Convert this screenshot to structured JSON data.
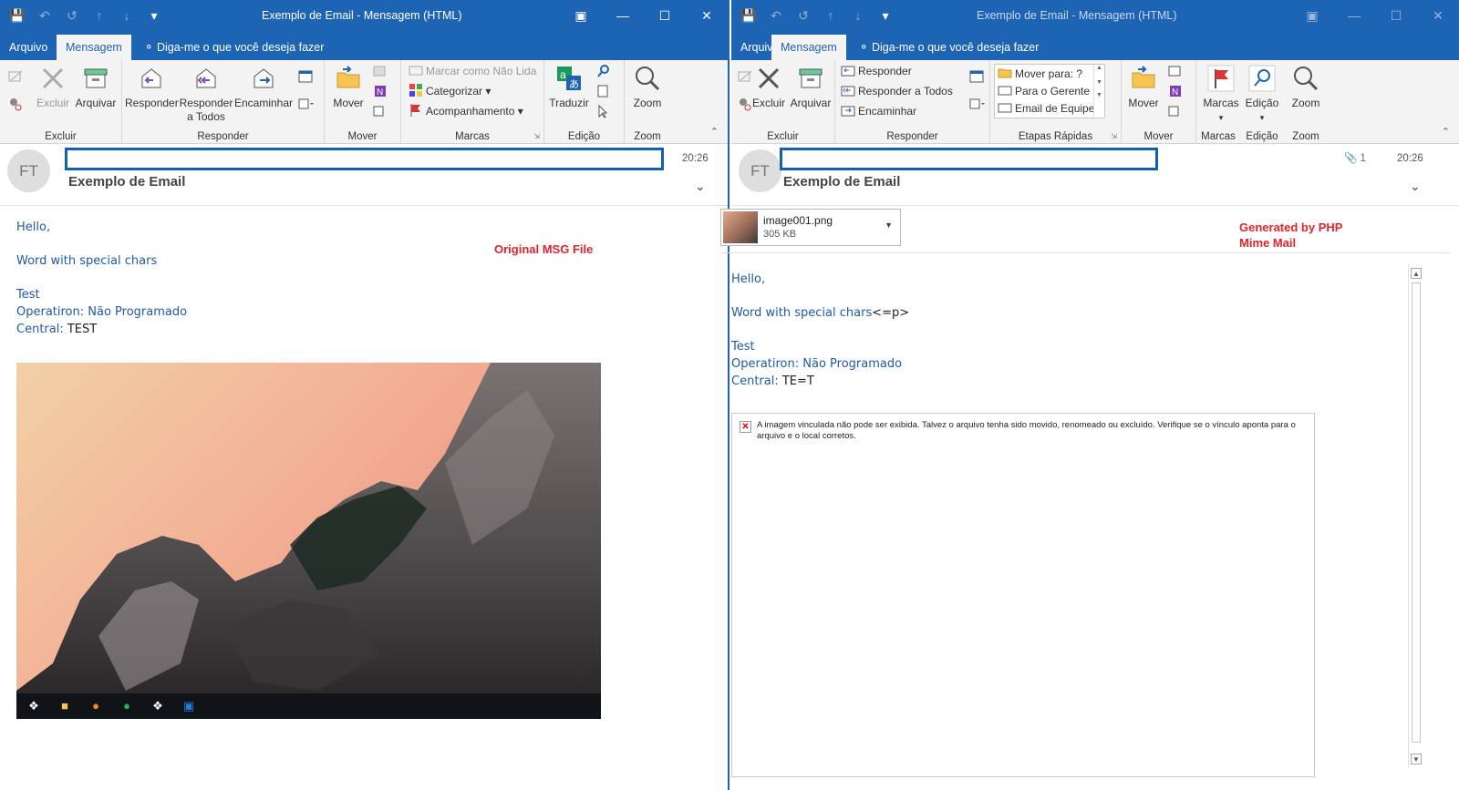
{
  "left": {
    "window_title": "Exemplo de Email  -  Mensagem (HTML)",
    "tabs": {
      "file": "Arquivo",
      "message": "Mensagem",
      "tell_me": "Diga-me o que você deseja fazer"
    },
    "ribbon": {
      "delete_group": {
        "label": "Excluir",
        "ignore": "Ignorar",
        "delete": "Excluir",
        "archive": "Arquivar"
      },
      "respond_group": {
        "label": "Responder",
        "reply": "Responder",
        "reply_all": "Responder a Todos",
        "forward": "Encaminhar"
      },
      "move_group": {
        "label": "Mover",
        "move": "Mover"
      },
      "tags_group": {
        "label": "Marcas",
        "mark_unread": "Marcar como Não Lida",
        "categorize": "Categorizar",
        "followup": "Acompanhamento"
      },
      "edit_group": {
        "label": "Edição",
        "translate": "Traduzir"
      },
      "zoom_group": {
        "label": "Zoom",
        "zoom": "Zoom"
      }
    },
    "header": {
      "avatar_initials": "FT",
      "subject": "Exemplo de Email",
      "time": "20:26"
    },
    "annotation": "Original MSG File",
    "body": {
      "greeting": "Hello,",
      "line1": "Word with special chars",
      "test": "Test",
      "operatiron_label": "Operatiron: ",
      "operatiron_value": "Não Programado",
      "central_label": "Central: ",
      "central_value": "TEST"
    },
    "taskbar_icons": [
      "windows-start-icon",
      "file-explorer-icon",
      "firefox-icon",
      "spotify-icon",
      "slack-icon",
      "outlook-icon"
    ]
  },
  "right": {
    "window_title": "Exemplo de Email  -  Mensagem (HTML)",
    "tabs": {
      "file": "Arquivo",
      "message": "Mensagem",
      "tell_me": "Diga-me o que você deseja fazer"
    },
    "ribbon": {
      "delete_group": {
        "label": "Excluir",
        "delete": "Excluir",
        "archive": "Arquivar"
      },
      "respond_group": {
        "label": "Responder",
        "reply": "Responder",
        "reply_all": "Responder a Todos",
        "forward": "Encaminhar"
      },
      "quick_steps_group": {
        "label": "Etapas Rápidas",
        "items": [
          "Mover para: ?",
          "Para o Gerente",
          "Email de Equipe"
        ]
      },
      "move_group": {
        "label": "Mover",
        "move": "Mover"
      },
      "tags_group": {
        "label": "Marcas",
        "tags": "Marcas"
      },
      "edit_group": {
        "label": "Edição",
        "edit": "Edição"
      },
      "zoom_group": {
        "label": "Zoom",
        "zoom": "Zoom"
      }
    },
    "header": {
      "avatar_initials": "FT",
      "subject": "Exemplo de Email",
      "time": "20:26",
      "attachment_count": "1"
    },
    "attachment": {
      "name": "image001.png",
      "size": "305 KB"
    },
    "annotation_line1": "Generated by PHP",
    "annotation_line2": "Mime Mail",
    "body": {
      "greeting": "Hello,",
      "line1": "Word with special chars",
      "line1_suffix": "<=p>",
      "test": "Test",
      "operatiron_label": "Operatiron: ",
      "operatiron_value": "Não Programado",
      "central_label": "Central: ",
      "central_value": "TE=T"
    },
    "broken_image_message": "A imagem vinculada não pode ser exibida. Talvez o arquivo tenha sido movido, renomeado ou excluído. Verifique se o vínculo aponta para o arquivo e o local corretos."
  },
  "colors": {
    "titlebar": "#1e64b4",
    "ribbon_bg": "#f3f3f3",
    "body_text": "#1f5aa6",
    "annotation_red": "#e4222e"
  }
}
